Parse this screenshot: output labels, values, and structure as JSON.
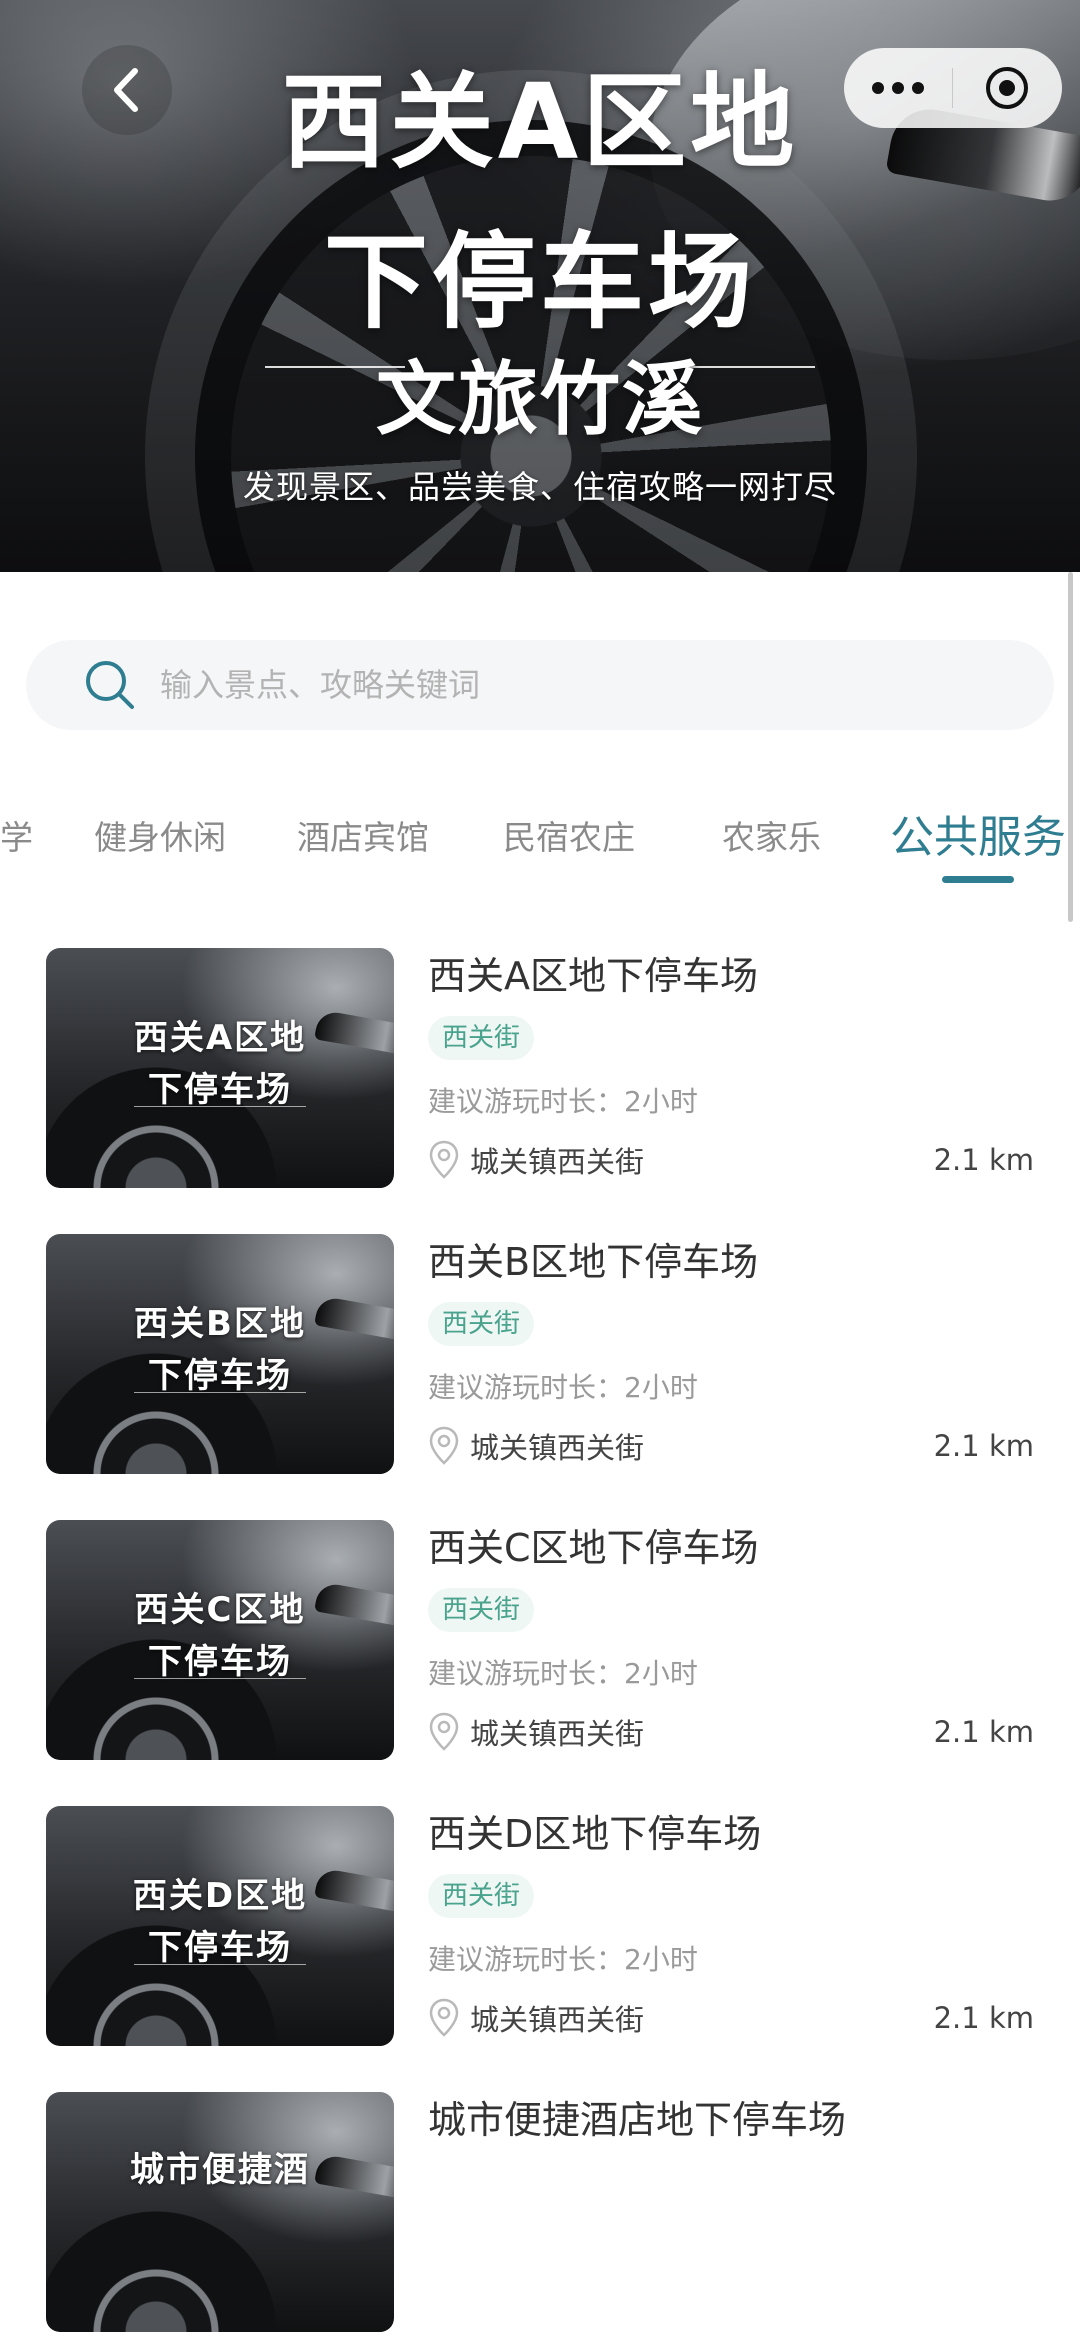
{
  "hero": {
    "title_line1": "西关A区地",
    "title_line2": "下停车场",
    "brand": "文旅竹溪",
    "subtitle": "发现景区、品尝美食、住宿攻略一网打尽"
  },
  "nav": {
    "back_icon": "chevron-left-icon",
    "more_icon": "more-dots-icon",
    "close_icon": "target-circle-icon"
  },
  "search": {
    "placeholder": "输入景点、攻略关键词",
    "value": ""
  },
  "tabs": [
    {
      "label": "学",
      "active": false
    },
    {
      "label": "健身休闲",
      "active": false
    },
    {
      "label": "酒店宾馆",
      "active": false
    },
    {
      "label": "民宿农庄",
      "active": false
    },
    {
      "label": "农家乐",
      "active": false
    },
    {
      "label": "公共服务",
      "active": true
    }
  ],
  "items": [
    {
      "thumb_line1": "西关A区地",
      "thumb_line2": "下停车场",
      "title": "西关A区地下停车场",
      "tag": "西关街",
      "duration": "建议游玩时长：2小时",
      "address": "城关镇西关街",
      "distance": "2.1 km"
    },
    {
      "thumb_line1": "西关B区地",
      "thumb_line2": "下停车场",
      "title": "西关B区地下停车场",
      "tag": "西关街",
      "duration": "建议游玩时长：2小时",
      "address": "城关镇西关街",
      "distance": "2.1 km"
    },
    {
      "thumb_line1": "西关C区地",
      "thumb_line2": "下停车场",
      "title": "西关C区地下停车场",
      "tag": "西关街",
      "duration": "建议游玩时长：2小时",
      "address": "城关镇西关街",
      "distance": "2.1 km"
    },
    {
      "thumb_line1": "西关D区地",
      "thumb_line2": "下停车场",
      "title": "西关D区地下停车场",
      "tag": "西关街",
      "duration": "建议游玩时长：2小时",
      "address": "城关镇西关街",
      "distance": "2.1 km"
    },
    {
      "thumb_line1": "城市便捷酒",
      "thumb_line2": "",
      "title": "城市便捷酒店地下停车场"
    }
  ],
  "colors": {
    "accent": "#2f7d90",
    "tag_bg": "#eef7f4",
    "tag_text": "#4aa38d"
  }
}
